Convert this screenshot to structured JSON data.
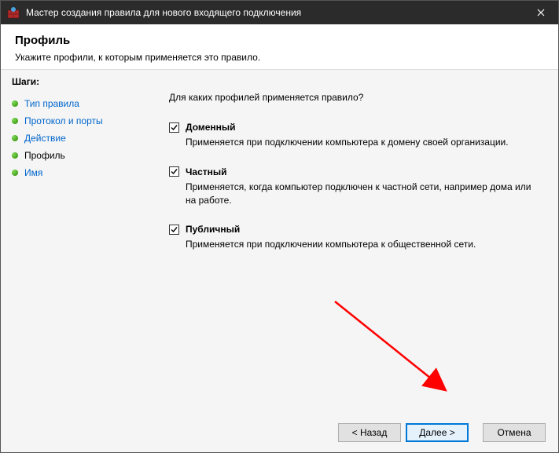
{
  "titlebar": {
    "title": "Мастер создания правила для нового входящего подключения"
  },
  "header": {
    "title": "Профиль",
    "subtitle": "Укажите профили, к которым применяется это правило."
  },
  "steps": {
    "heading": "Шаги:",
    "items": [
      {
        "label": "Тип правила",
        "state": "link"
      },
      {
        "label": "Протокол и порты",
        "state": "link"
      },
      {
        "label": "Действие",
        "state": "link"
      },
      {
        "label": "Профиль",
        "state": "current"
      },
      {
        "label": "Имя",
        "state": "link"
      }
    ]
  },
  "content": {
    "question": "Для каких профилей применяется правило?",
    "profiles": [
      {
        "checked": true,
        "title": "Доменный",
        "desc": "Применяется при подключении компьютера к домену своей организации."
      },
      {
        "checked": true,
        "title": "Частный",
        "desc": "Применяется, когда компьютер подключен к частной сети, например дома или на работе."
      },
      {
        "checked": true,
        "title": "Публичный",
        "desc": "Применяется при подключении компьютера к общественной сети."
      }
    ]
  },
  "footer": {
    "back": "< Назад",
    "next": "Далее >",
    "cancel": "Отмена"
  }
}
